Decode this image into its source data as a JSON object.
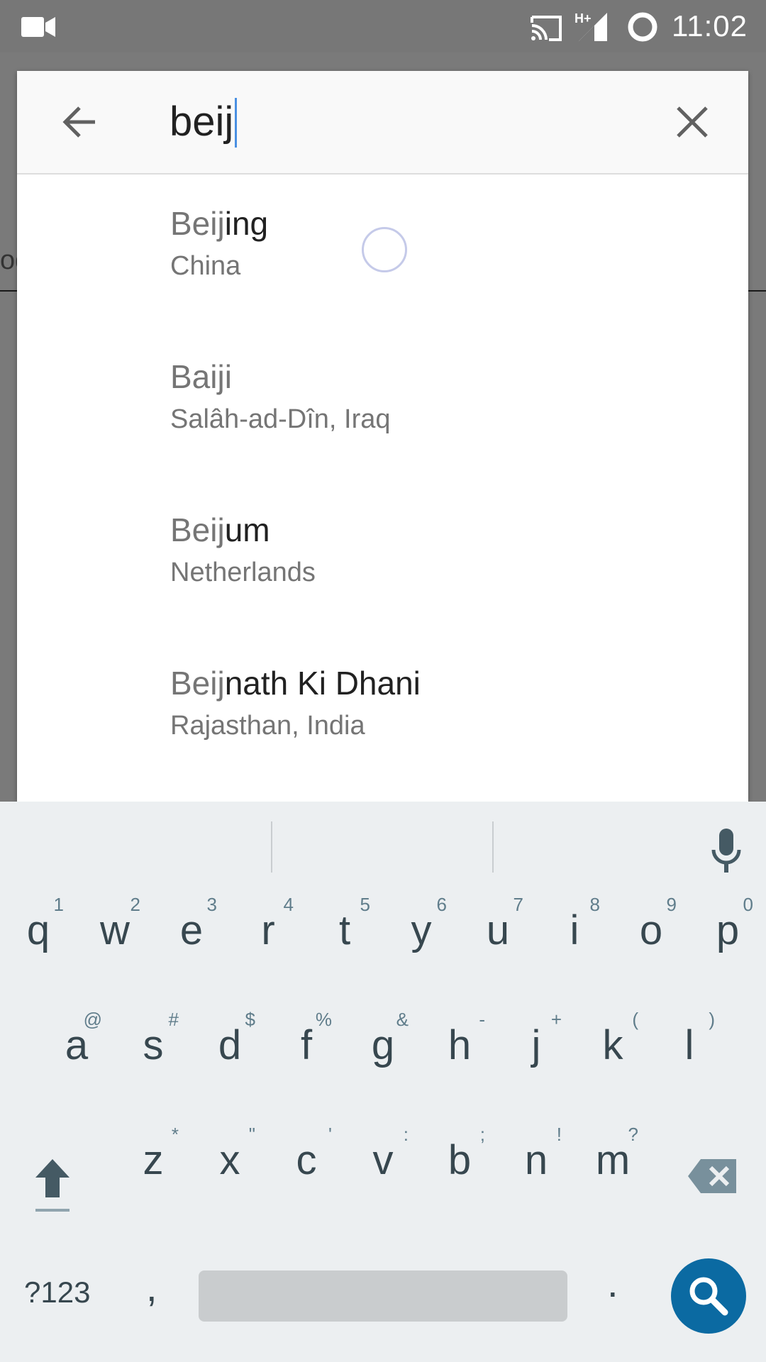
{
  "status_bar": {
    "time": "11:02",
    "icons": [
      "video-camera-icon",
      "cast-icon",
      "hplus-signal-icon",
      "ring-icon"
    ]
  },
  "background": {
    "partial_text": "od"
  },
  "search": {
    "query": "beij",
    "back_icon": "arrow-left-icon",
    "clear_icon": "close-icon"
  },
  "results": [
    {
      "match": "Beij",
      "rest": "ing",
      "subtitle": "China"
    },
    {
      "match": "Baiji",
      "rest": "",
      "subtitle": "Salâh-ad-Dîn, Iraq"
    },
    {
      "match": "Beij",
      "rest": "um",
      "subtitle": "Netherlands"
    },
    {
      "match": "Beij",
      "rest": "nath Ki Dhani",
      "subtitle": "Rajasthan, India"
    }
  ],
  "keyboard": {
    "row1": [
      {
        "k": "q",
        "h": "1"
      },
      {
        "k": "w",
        "h": "2"
      },
      {
        "k": "e",
        "h": "3"
      },
      {
        "k": "r",
        "h": "4"
      },
      {
        "k": "t",
        "h": "5"
      },
      {
        "k": "y",
        "h": "6"
      },
      {
        "k": "u",
        "h": "7"
      },
      {
        "k": "i",
        "h": "8"
      },
      {
        "k": "o",
        "h": "9"
      },
      {
        "k": "p",
        "h": "0"
      }
    ],
    "row2": [
      {
        "k": "a",
        "h": "@"
      },
      {
        "k": "s",
        "h": "#"
      },
      {
        "k": "d",
        "h": "$"
      },
      {
        "k": "f",
        "h": "%"
      },
      {
        "k": "g",
        "h": "&"
      },
      {
        "k": "h",
        "h": "-"
      },
      {
        "k": "j",
        "h": "+"
      },
      {
        "k": "k",
        "h": "("
      },
      {
        "k": "l",
        "h": ")"
      }
    ],
    "row3": [
      {
        "k": "z",
        "h": "*"
      },
      {
        "k": "x",
        "h": "\""
      },
      {
        "k": "c",
        "h": "'"
      },
      {
        "k": "v",
        "h": ":"
      },
      {
        "k": "b",
        "h": ";"
      },
      {
        "k": "n",
        "h": "!"
      },
      {
        "k": "m",
        "h": "?"
      }
    ],
    "symbols_label": "?123",
    "comma_label": ",",
    "period_label": ".",
    "shift_icon": "shift-arrow-icon",
    "backspace_icon": "backspace-icon",
    "mic_icon": "microphone-icon",
    "search_icon": "search-icon",
    "accent_color": "#0b6aa2"
  }
}
